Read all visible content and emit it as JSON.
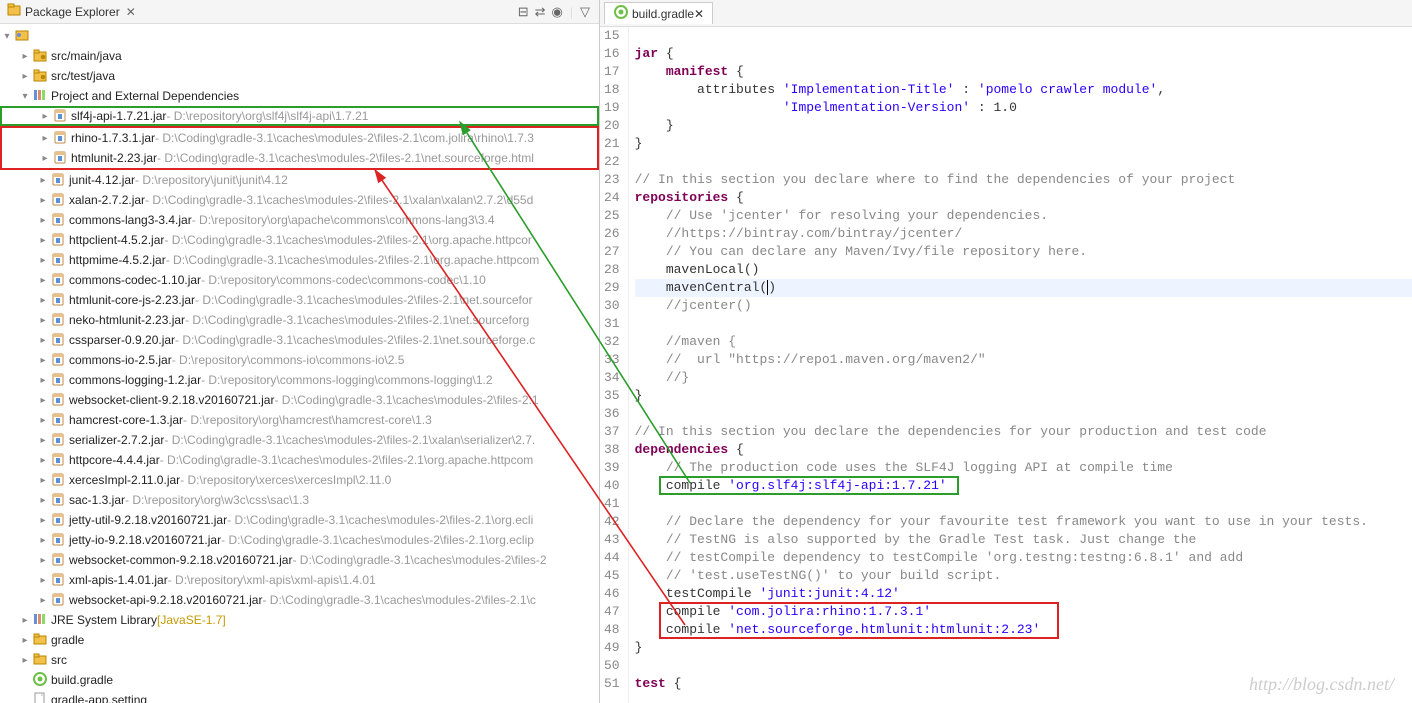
{
  "watermark": "http://blog.csdn.net/",
  "left": {
    "title": "Package Explorer",
    "nodes": {
      "src_main": "src/main/java",
      "src_test": "src/test/java",
      "deps_label": "Project and External Dependencies",
      "jre": "JRE System Library",
      "jre_tag": "[JavaSE-1.7]",
      "gradle": "gradle",
      "src": "src",
      "build_gradle": "build.gradle",
      "gradle_app": "gradle-app.setting"
    },
    "jars": [
      {
        "name": "slf4j-api-1.7.21.jar",
        "path": " - D:\\repository\\org\\slf4j\\slf4j-api\\1.7.21",
        "box": "green"
      },
      {
        "name": "rhino-1.7.3.1.jar",
        "path": " - D:\\Coding\\gradle-3.1\\caches\\modules-2\\files-2.1\\com.jolira\\rhino\\1.7.3",
        "box": "red-top"
      },
      {
        "name": "htmlunit-2.23.jar",
        "path": " - D:\\Coding\\gradle-3.1\\caches\\modules-2\\files-2.1\\net.sourceforge.html",
        "box": "red-bottom"
      },
      {
        "name": "junit-4.12.jar",
        "path": " - D:\\repository\\junit\\junit\\4.12"
      },
      {
        "name": "xalan-2.7.2.jar",
        "path": " - D:\\Coding\\gradle-3.1\\caches\\modules-2\\files-2.1\\xalan\\xalan\\2.7.2\\d55d"
      },
      {
        "name": "commons-lang3-3.4.jar",
        "path": " - D:\\repository\\org\\apache\\commons\\commons-lang3\\3.4"
      },
      {
        "name": "httpclient-4.5.2.jar",
        "path": " - D:\\Coding\\gradle-3.1\\caches\\modules-2\\files-2.1\\org.apache.httpcor"
      },
      {
        "name": "httpmime-4.5.2.jar",
        "path": " - D:\\Coding\\gradle-3.1\\caches\\modules-2\\files-2.1\\org.apache.httpcom"
      },
      {
        "name": "commons-codec-1.10.jar",
        "path": " - D:\\repository\\commons-codec\\commons-codec\\1.10"
      },
      {
        "name": "htmlunit-core-js-2.23.jar",
        "path": " - D:\\Coding\\gradle-3.1\\caches\\modules-2\\files-2.1\\net.sourcefor"
      },
      {
        "name": "neko-htmlunit-2.23.jar",
        "path": " - D:\\Coding\\gradle-3.1\\caches\\modules-2\\files-2.1\\net.sourceforg"
      },
      {
        "name": "cssparser-0.9.20.jar",
        "path": " - D:\\Coding\\gradle-3.1\\caches\\modules-2\\files-2.1\\net.sourceforge.c"
      },
      {
        "name": "commons-io-2.5.jar",
        "path": " - D:\\repository\\commons-io\\commons-io\\2.5"
      },
      {
        "name": "commons-logging-1.2.jar",
        "path": " - D:\\repository\\commons-logging\\commons-logging\\1.2"
      },
      {
        "name": "websocket-client-9.2.18.v20160721.jar",
        "path": " - D:\\Coding\\gradle-3.1\\caches\\modules-2\\files-2.1"
      },
      {
        "name": "hamcrest-core-1.3.jar",
        "path": " - D:\\repository\\org\\hamcrest\\hamcrest-core\\1.3"
      },
      {
        "name": "serializer-2.7.2.jar",
        "path": " - D:\\Coding\\gradle-3.1\\caches\\modules-2\\files-2.1\\xalan\\serializer\\2.7."
      },
      {
        "name": "httpcore-4.4.4.jar",
        "path": " - D:\\Coding\\gradle-3.1\\caches\\modules-2\\files-2.1\\org.apache.httpcom"
      },
      {
        "name": "xercesImpl-2.11.0.jar",
        "path": " - D:\\repository\\xerces\\xercesImpl\\2.11.0"
      },
      {
        "name": "sac-1.3.jar",
        "path": " - D:\\repository\\org\\w3c\\css\\sac\\1.3"
      },
      {
        "name": "jetty-util-9.2.18.v20160721.jar",
        "path": " - D:\\Coding\\gradle-3.1\\caches\\modules-2\\files-2.1\\org.ecli"
      },
      {
        "name": "jetty-io-9.2.18.v20160721.jar",
        "path": " - D:\\Coding\\gradle-3.1\\caches\\modules-2\\files-2.1\\org.eclip"
      },
      {
        "name": "websocket-common-9.2.18.v20160721.jar",
        "path": " - D:\\Coding\\gradle-3.1\\caches\\modules-2\\files-2"
      },
      {
        "name": "xml-apis-1.4.01.jar",
        "path": " - D:\\repository\\xml-apis\\xml-apis\\1.4.01"
      },
      {
        "name": "websocket-api-9.2.18.v20160721.jar",
        "path": " - D:\\Coding\\gradle-3.1\\caches\\modules-2\\files-2.1\\c"
      }
    ]
  },
  "right": {
    "tab": "build.gradle",
    "lines": [
      {
        "n": 15,
        "t": ""
      },
      {
        "n": 16,
        "t": "jar {",
        "tok": [
          [
            "kw",
            "jar"
          ],
          [
            "",
            ""
          ],
          [
            "pl",
            " {"
          ]
        ]
      },
      {
        "n": 17,
        "t": "    manifest {",
        "tok": [
          [
            "pl",
            "    "
          ],
          [
            "kw",
            "manifest"
          ],
          [
            "pl",
            " {"
          ]
        ]
      },
      {
        "n": 18,
        "t": "        attributes 'Implementation-Title' : 'pomelo crawler module',",
        "tok": [
          [
            "pl",
            "        attributes "
          ],
          [
            "str",
            "'Implementation-Title'"
          ],
          [
            "pl",
            " : "
          ],
          [
            "str",
            "'pomelo crawler module'"
          ],
          [
            "pl",
            ","
          ]
        ]
      },
      {
        "n": 19,
        "t": "                   'Impelmentation-Version' : 1.0",
        "tok": [
          [
            "pl",
            "                   "
          ],
          [
            "str",
            "'Impelmentation-Version'"
          ],
          [
            "pl",
            " : 1.0"
          ]
        ]
      },
      {
        "n": 20,
        "t": "    }"
      },
      {
        "n": 21,
        "t": "}"
      },
      {
        "n": 22,
        "t": ""
      },
      {
        "n": 23,
        "t": "// In this section you declare where to find the dependencies of your project",
        "cmt": true
      },
      {
        "n": 24,
        "t": "repositories {",
        "tok": [
          [
            "kw",
            "repositories"
          ],
          [
            "pl",
            " {"
          ]
        ]
      },
      {
        "n": 25,
        "t": "    // Use 'jcenter' for resolving your dependencies.",
        "cmt": true,
        "ind": "    "
      },
      {
        "n": 26,
        "t": "    //https://bintray.com/bintray/jcenter/",
        "cmt": true,
        "ind": "    "
      },
      {
        "n": 27,
        "t": "    // You can declare any Maven/Ivy/file repository here.",
        "cmt": true,
        "ind": "    "
      },
      {
        "n": 28,
        "t": "    mavenLocal()"
      },
      {
        "n": 29,
        "t": "    mavenCentral()",
        "hl": true,
        "caret": 17
      },
      {
        "n": 30,
        "t": "    //jcenter()",
        "cmt": true,
        "ind": "    "
      },
      {
        "n": 31,
        "t": "    "
      },
      {
        "n": 32,
        "t": "    //maven {",
        "cmt": true,
        "ind": "    "
      },
      {
        "n": 33,
        "t": "    //  url \"https://repo1.maven.org/maven2/\"",
        "cmt": true,
        "ind": "    "
      },
      {
        "n": 34,
        "t": "    //}",
        "cmt": true,
        "ind": "    "
      },
      {
        "n": 35,
        "t": "}"
      },
      {
        "n": 36,
        "t": ""
      },
      {
        "n": 37,
        "t": "// In this section you declare the dependencies for your production and test code",
        "cmt": true
      },
      {
        "n": 38,
        "t": "dependencies {",
        "tok": [
          [
            "kw",
            "dependencies"
          ],
          [
            "pl",
            " {"
          ]
        ]
      },
      {
        "n": 39,
        "t": "    // The production code uses the SLF4J logging API at compile time",
        "cmt": true,
        "ind": "    "
      },
      {
        "n": 40,
        "t": "    compile 'org.slf4j:slf4j-api:1.7.21'",
        "tok": [
          [
            "pl",
            "    compile "
          ],
          [
            "str",
            "'org.slf4j:slf4j-api:1.7.21'"
          ]
        ]
      },
      {
        "n": 41,
        "t": ""
      },
      {
        "n": 42,
        "t": "    // Declare the dependency for your favourite test framework you want to use in your tests.",
        "cmt": true,
        "ind": "    "
      },
      {
        "n": 43,
        "t": "    // TestNG is also supported by the Gradle Test task. Just change the",
        "cmt": true,
        "ind": "    "
      },
      {
        "n": 44,
        "t": "    // testCompile dependency to testCompile 'org.testng:testng:6.8.1' and add",
        "cmt": true,
        "ind": "    "
      },
      {
        "n": 45,
        "t": "    // 'test.useTestNG()' to your build script.",
        "cmt": true,
        "ind": "    "
      },
      {
        "n": 46,
        "t": "    testCompile 'junit:junit:4.12'",
        "tok": [
          [
            "pl",
            "    testCompile "
          ],
          [
            "str",
            "'junit:junit:4.12'"
          ]
        ]
      },
      {
        "n": 47,
        "t": "    compile 'com.jolira:rhino:1.7.3.1'",
        "tok": [
          [
            "pl",
            "    compile "
          ],
          [
            "str",
            "'com.jolira:rhino:1.7.3.1'"
          ]
        ]
      },
      {
        "n": 48,
        "t": "    compile 'net.sourceforge.htmlunit:htmlunit:2.23'",
        "tok": [
          [
            "pl",
            "    compile "
          ],
          [
            "str",
            "'net.sourceforge.htmlunit:htmlunit:2.23'"
          ]
        ]
      },
      {
        "n": 49,
        "t": "}"
      },
      {
        "n": 50,
        "t": ""
      },
      {
        "n": 51,
        "t": "test {",
        "tok": [
          [
            "kw",
            "test"
          ],
          [
            "pl",
            " {"
          ]
        ]
      }
    ]
  }
}
